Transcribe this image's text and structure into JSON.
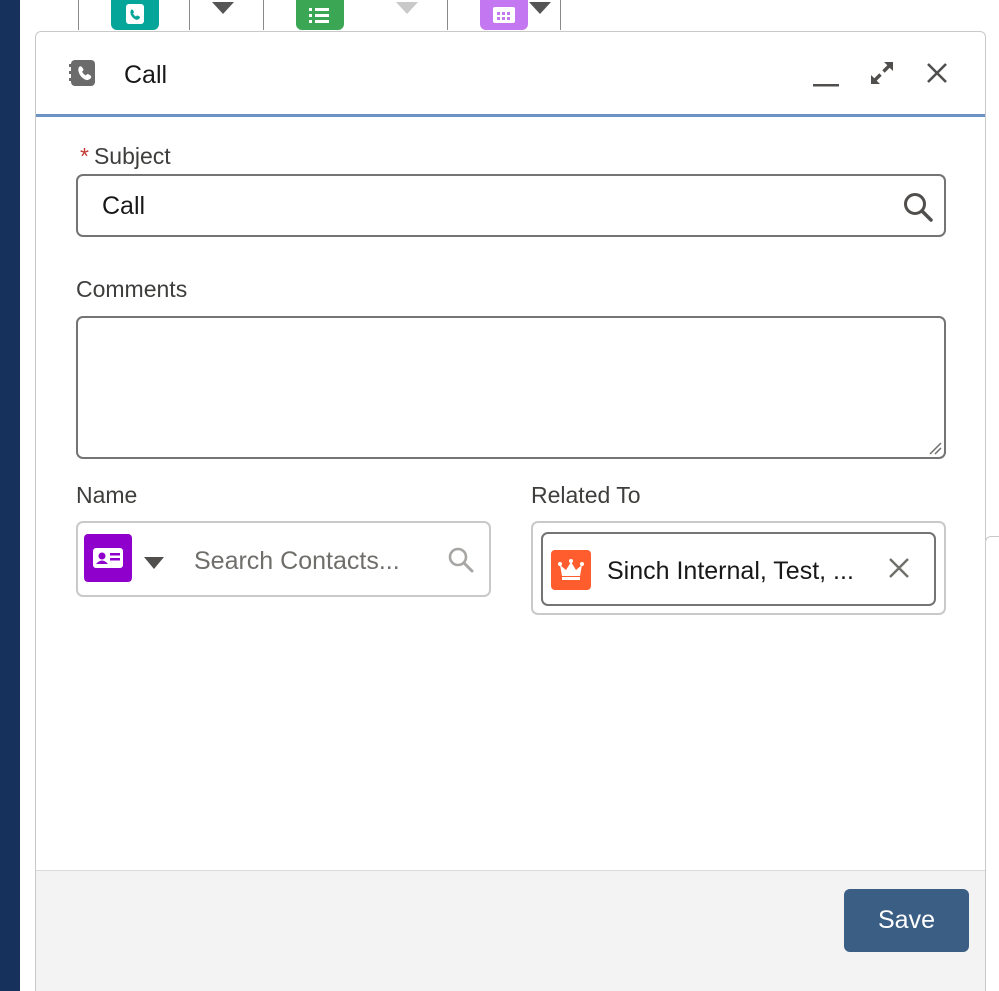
{
  "top_actions": [
    {
      "icon": "log-a-call-icon",
      "color": "#06a59a"
    },
    {
      "icon": "new-task-icon",
      "color": "#3ba755"
    },
    {
      "icon": "new-event-icon",
      "color": "#c377f1"
    }
  ],
  "modal": {
    "title": "Call",
    "title_icon": "log-a-call-icon",
    "controls": [
      "minimize-icon",
      "expand-icon",
      "close-icon"
    ]
  },
  "form": {
    "subject": {
      "label": "Subject",
      "required_marker": "*",
      "value": "Call"
    },
    "comments": {
      "label": "Comments",
      "value": ""
    },
    "name": {
      "label": "Name",
      "placeholder": "Search Contacts...",
      "object_icon": "contact-icon",
      "object_color": "#8f00cc"
    },
    "related_to": {
      "label": "Related To",
      "pill_label": "Sinch Internal, Test, ...",
      "pill_icon": "account-crown-icon",
      "pill_color": "#ff5d2d"
    }
  },
  "footer": {
    "save_label": "Save"
  },
  "colors": {
    "accent": "#3b5e85",
    "header_divider": "#6b93c4",
    "required": "#c23934"
  }
}
